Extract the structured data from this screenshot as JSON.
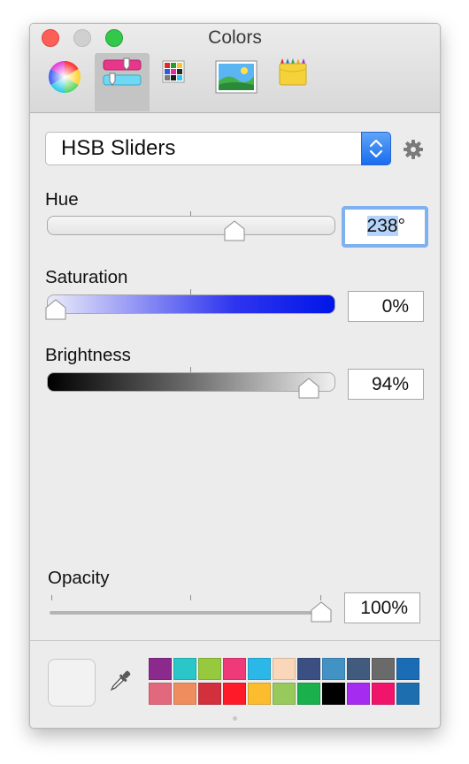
{
  "window": {
    "title": "Colors",
    "tabs": [
      {
        "name": "color-wheel",
        "selected": false
      },
      {
        "name": "color-sliders",
        "selected": true
      },
      {
        "name": "color-palettes",
        "selected": false
      },
      {
        "name": "image-palettes",
        "selected": false
      },
      {
        "name": "crayons",
        "selected": false
      }
    ]
  },
  "mode_popup": {
    "value": "HSB Sliders"
  },
  "sliders": {
    "hue": {
      "label": "Hue",
      "value": "238",
      "unit": "°",
      "fraction": 0.66
    },
    "saturation": {
      "label": "Saturation",
      "value": "0%",
      "fraction": 0.0
    },
    "brightness": {
      "label": "Brightness",
      "value": "94%",
      "fraction": 0.94
    }
  },
  "opacity": {
    "label": "Opacity",
    "value": "100%",
    "fraction": 1.0
  },
  "current_color": "#f2f2f2",
  "swatches": [
    "#8b2a8c",
    "#2ac6c8",
    "#96c93d",
    "#ee3a78",
    "#2bb8e8",
    "#fad7b8",
    "#3c4f83",
    "#4292c6",
    "#415b7e",
    "#6a6a6a",
    "#1a6db5",
    "#e2697d",
    "#ef8d5e",
    "#d1303c",
    "#ff1a2a",
    "#fbbd2d",
    "#98c95c",
    "#1ab04c",
    "#000000",
    "#a62bf0",
    "#f0146a",
    "#1d6eae"
  ],
  "icons": [
    "color-wheel-icon",
    "sliders-icon",
    "palette-grid-icon",
    "image-icon",
    "crayons-icon",
    "gear-icon",
    "eyedropper-icon",
    "stepper-icon"
  ]
}
